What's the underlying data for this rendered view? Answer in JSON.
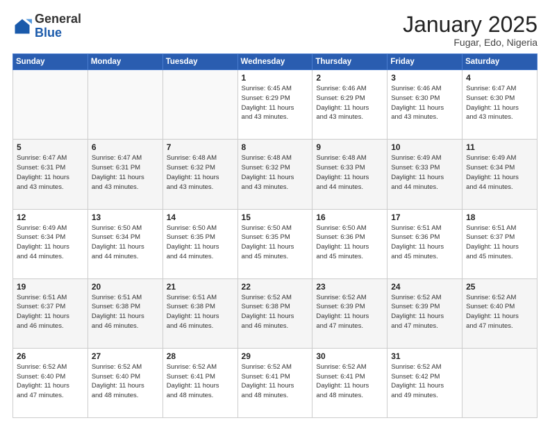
{
  "logo": {
    "general": "General",
    "blue": "Blue"
  },
  "header": {
    "month": "January 2025",
    "location": "Fugar, Edo, Nigeria"
  },
  "weekdays": [
    "Sunday",
    "Monday",
    "Tuesday",
    "Wednesday",
    "Thursday",
    "Friday",
    "Saturday"
  ],
  "weeks": [
    [
      {
        "day": "",
        "info": ""
      },
      {
        "day": "",
        "info": ""
      },
      {
        "day": "",
        "info": ""
      },
      {
        "day": "1",
        "info": "Sunrise: 6:45 AM\nSunset: 6:29 PM\nDaylight: 11 hours\nand 43 minutes."
      },
      {
        "day": "2",
        "info": "Sunrise: 6:46 AM\nSunset: 6:29 PM\nDaylight: 11 hours\nand 43 minutes."
      },
      {
        "day": "3",
        "info": "Sunrise: 6:46 AM\nSunset: 6:30 PM\nDaylight: 11 hours\nand 43 minutes."
      },
      {
        "day": "4",
        "info": "Sunrise: 6:47 AM\nSunset: 6:30 PM\nDaylight: 11 hours\nand 43 minutes."
      }
    ],
    [
      {
        "day": "5",
        "info": "Sunrise: 6:47 AM\nSunset: 6:31 PM\nDaylight: 11 hours\nand 43 minutes."
      },
      {
        "day": "6",
        "info": "Sunrise: 6:47 AM\nSunset: 6:31 PM\nDaylight: 11 hours\nand 43 minutes."
      },
      {
        "day": "7",
        "info": "Sunrise: 6:48 AM\nSunset: 6:32 PM\nDaylight: 11 hours\nand 43 minutes."
      },
      {
        "day": "8",
        "info": "Sunrise: 6:48 AM\nSunset: 6:32 PM\nDaylight: 11 hours\nand 43 minutes."
      },
      {
        "day": "9",
        "info": "Sunrise: 6:48 AM\nSunset: 6:33 PM\nDaylight: 11 hours\nand 44 minutes."
      },
      {
        "day": "10",
        "info": "Sunrise: 6:49 AM\nSunset: 6:33 PM\nDaylight: 11 hours\nand 44 minutes."
      },
      {
        "day": "11",
        "info": "Sunrise: 6:49 AM\nSunset: 6:34 PM\nDaylight: 11 hours\nand 44 minutes."
      }
    ],
    [
      {
        "day": "12",
        "info": "Sunrise: 6:49 AM\nSunset: 6:34 PM\nDaylight: 11 hours\nand 44 minutes."
      },
      {
        "day": "13",
        "info": "Sunrise: 6:50 AM\nSunset: 6:34 PM\nDaylight: 11 hours\nand 44 minutes."
      },
      {
        "day": "14",
        "info": "Sunrise: 6:50 AM\nSunset: 6:35 PM\nDaylight: 11 hours\nand 44 minutes."
      },
      {
        "day": "15",
        "info": "Sunrise: 6:50 AM\nSunset: 6:35 PM\nDaylight: 11 hours\nand 45 minutes."
      },
      {
        "day": "16",
        "info": "Sunrise: 6:50 AM\nSunset: 6:36 PM\nDaylight: 11 hours\nand 45 minutes."
      },
      {
        "day": "17",
        "info": "Sunrise: 6:51 AM\nSunset: 6:36 PM\nDaylight: 11 hours\nand 45 minutes."
      },
      {
        "day": "18",
        "info": "Sunrise: 6:51 AM\nSunset: 6:37 PM\nDaylight: 11 hours\nand 45 minutes."
      }
    ],
    [
      {
        "day": "19",
        "info": "Sunrise: 6:51 AM\nSunset: 6:37 PM\nDaylight: 11 hours\nand 46 minutes."
      },
      {
        "day": "20",
        "info": "Sunrise: 6:51 AM\nSunset: 6:38 PM\nDaylight: 11 hours\nand 46 minutes."
      },
      {
        "day": "21",
        "info": "Sunrise: 6:51 AM\nSunset: 6:38 PM\nDaylight: 11 hours\nand 46 minutes."
      },
      {
        "day": "22",
        "info": "Sunrise: 6:52 AM\nSunset: 6:38 PM\nDaylight: 11 hours\nand 46 minutes."
      },
      {
        "day": "23",
        "info": "Sunrise: 6:52 AM\nSunset: 6:39 PM\nDaylight: 11 hours\nand 47 minutes."
      },
      {
        "day": "24",
        "info": "Sunrise: 6:52 AM\nSunset: 6:39 PM\nDaylight: 11 hours\nand 47 minutes."
      },
      {
        "day": "25",
        "info": "Sunrise: 6:52 AM\nSunset: 6:40 PM\nDaylight: 11 hours\nand 47 minutes."
      }
    ],
    [
      {
        "day": "26",
        "info": "Sunrise: 6:52 AM\nSunset: 6:40 PM\nDaylight: 11 hours\nand 47 minutes."
      },
      {
        "day": "27",
        "info": "Sunrise: 6:52 AM\nSunset: 6:40 PM\nDaylight: 11 hours\nand 48 minutes."
      },
      {
        "day": "28",
        "info": "Sunrise: 6:52 AM\nSunset: 6:41 PM\nDaylight: 11 hours\nand 48 minutes."
      },
      {
        "day": "29",
        "info": "Sunrise: 6:52 AM\nSunset: 6:41 PM\nDaylight: 11 hours\nand 48 minutes."
      },
      {
        "day": "30",
        "info": "Sunrise: 6:52 AM\nSunset: 6:41 PM\nDaylight: 11 hours\nand 48 minutes."
      },
      {
        "day": "31",
        "info": "Sunrise: 6:52 AM\nSunset: 6:42 PM\nDaylight: 11 hours\nand 49 minutes."
      },
      {
        "day": "",
        "info": ""
      }
    ]
  ]
}
